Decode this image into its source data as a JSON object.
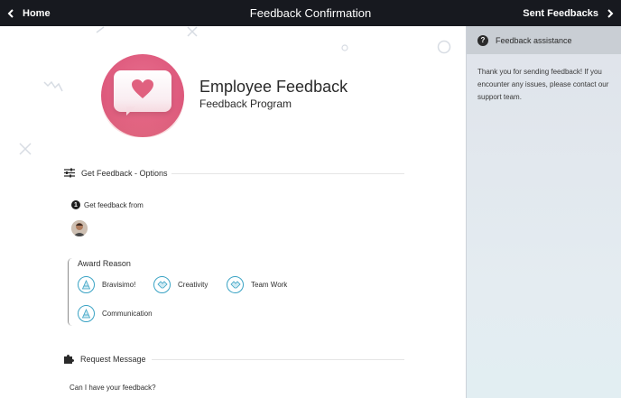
{
  "topbar": {
    "home_label": "Home",
    "title": "Feedback Confirmation",
    "sent_label": "Sent Feedbacks"
  },
  "app": {
    "title": "Employee Feedback",
    "subtitle": "Feedback Program"
  },
  "options": {
    "heading": "Get Feedback - Options",
    "step_number": "1",
    "step_label": "Get feedback from",
    "award_label": "Award Reason",
    "awards": [
      {
        "label": "Bravisimo!",
        "icon": "cone-icon"
      },
      {
        "label": "Creativity",
        "icon": "handshake-icon"
      },
      {
        "label": "Team Work",
        "icon": "handshake-icon"
      },
      {
        "label": "Communication",
        "icon": "cone-icon"
      }
    ]
  },
  "request": {
    "heading": "Request Message",
    "message": "Can I have your feedback?"
  },
  "panel": {
    "heading": "Feedback assistance",
    "text": "Thank you for sending feedback! If you encounter any issues, please contact our support team."
  },
  "colors": {
    "topbar": "#17191f",
    "accent": "#de5a7d",
    "award_icon": "#3aa3c4",
    "panel_head": "#c9ced4"
  }
}
